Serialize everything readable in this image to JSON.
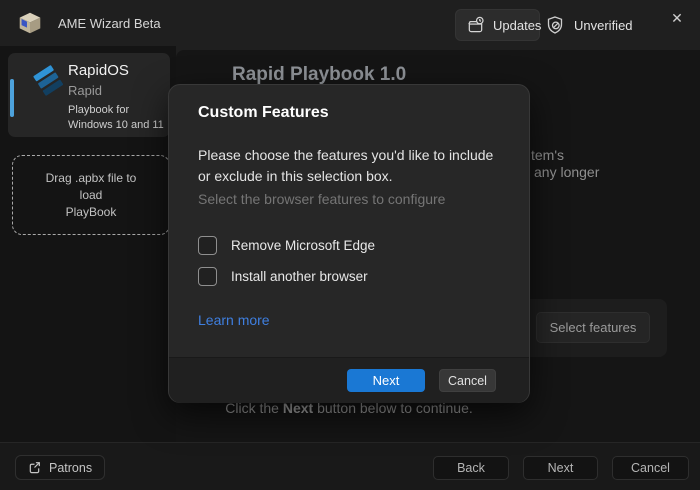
{
  "titlebar": {
    "app_title": "AME Wizard Beta",
    "updates_label": "Updates",
    "unverified_label": "Unverified",
    "close_glyph": "✕"
  },
  "sidebar": {
    "playbook_card": {
      "title": "RapidOS",
      "subtitle": "Rapid",
      "description": "Playbook for Windows 10 and 11"
    },
    "drop_zone": {
      "line1": "Drag .apbx file to",
      "line2": "load",
      "line3": "PlayBook"
    }
  },
  "main": {
    "page_title": "Rapid Playbook 1.0",
    "fragments": [
      "tem's",
      "any longer"
    ],
    "select_features_label": "Select features",
    "continue_hint": {
      "prefix": "Click the ",
      "bold": "Next",
      "suffix": " button below to continue."
    }
  },
  "dialog": {
    "title": "Custom Features",
    "description_line1": "Please choose the features you'd like to include",
    "description_line2": "or exclude in this selection box.",
    "hint": "Select the browser features to configure",
    "checkboxes": [
      {
        "label": "Remove Microsoft Edge",
        "checked": false
      },
      {
        "label": "Install another browser",
        "checked": false
      }
    ],
    "link_label": "Learn more",
    "primary_label": "Next",
    "secondary_label": "Cancel"
  },
  "footer": {
    "patrons_label": "Patrons",
    "back_label": "Back",
    "next_label": "Next",
    "cancel_label": "Cancel"
  },
  "colors": {
    "accent_blue": "#1a78d4",
    "link_blue": "#3f7fe0",
    "sidebar_accent": "#4da2dc"
  }
}
